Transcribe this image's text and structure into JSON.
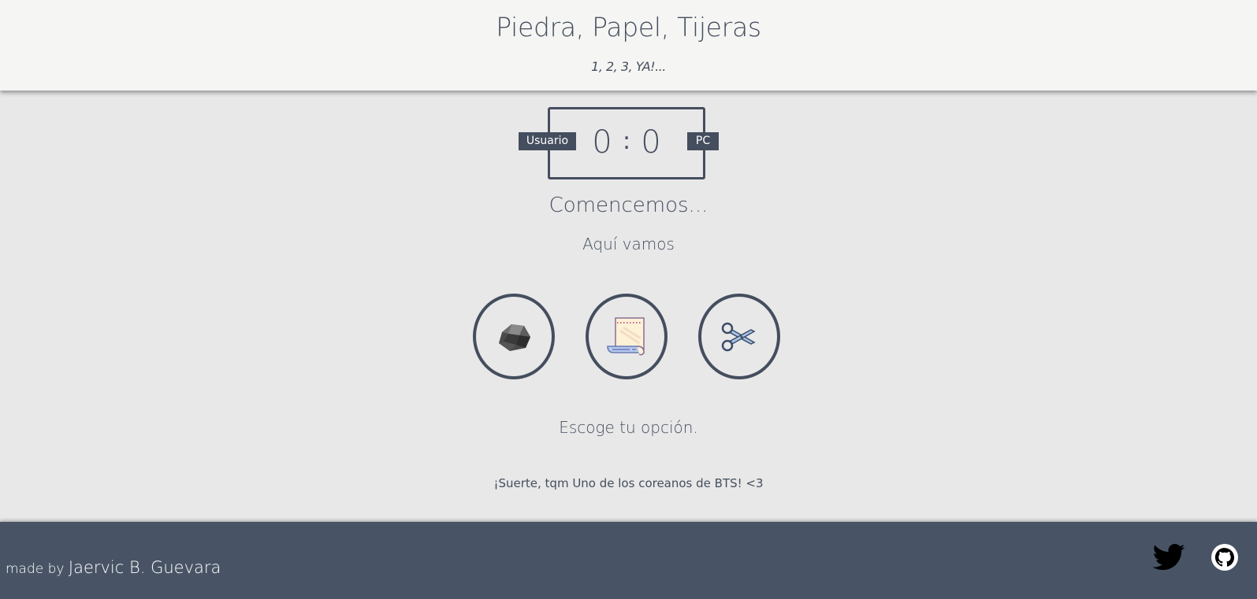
{
  "header": {
    "title": "Piedra, Papel, Tijeras",
    "subtitle": "1, 2, 3, YA!..."
  },
  "scoreboard": {
    "user_label": "Usuario",
    "pc_label": "PC",
    "user_score": "0",
    "pc_score": "0",
    "separator": ":"
  },
  "status": {
    "main": "Comencemos...",
    "sub": "Aquí vamos"
  },
  "choices": [
    {
      "name": "rock",
      "icon": "rock-icon"
    },
    {
      "name": "paper",
      "icon": "paper-icon"
    },
    {
      "name": "scissors",
      "icon": "scissors-icon"
    }
  ],
  "prompt": "Escoge tu opción.",
  "message": "¡Suerte, tqm Uno de los coreanos de BTS! <3",
  "footer": {
    "made_by": "made by",
    "author": "Jaervic B. Guevara",
    "social": [
      {
        "name": "twitter",
        "icon": "twitter-icon"
      },
      {
        "name": "github",
        "icon": "github-icon"
      }
    ]
  },
  "colors": {
    "primary": "#454e5e",
    "background": "#e8e8e8",
    "header_bg": "#f5f5f3",
    "footer_bg": "#485465"
  }
}
